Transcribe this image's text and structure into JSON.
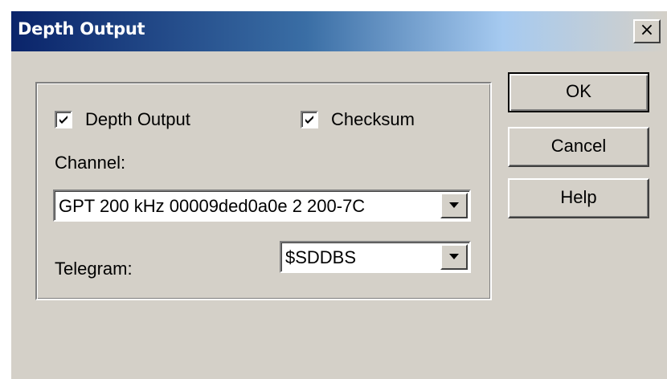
{
  "window": {
    "title": "Depth Output",
    "close_glyph": "×"
  },
  "group": {
    "depth_output": {
      "label": "Depth Output",
      "checked": true
    },
    "checksum": {
      "label": "Checksum",
      "checked": true
    },
    "channel_label": "Channel:",
    "channel_value": "GPT 200 kHz 00009ded0a0e 2 200-7C",
    "telegram_label": "Telegram:",
    "telegram_value": "$SDDBS"
  },
  "buttons": {
    "ok": "OK",
    "cancel": "Cancel",
    "help": "Help"
  },
  "colors": {
    "title_start": "#0a246a",
    "title_end": "#a6caf0",
    "face": "#d4d0c8"
  }
}
